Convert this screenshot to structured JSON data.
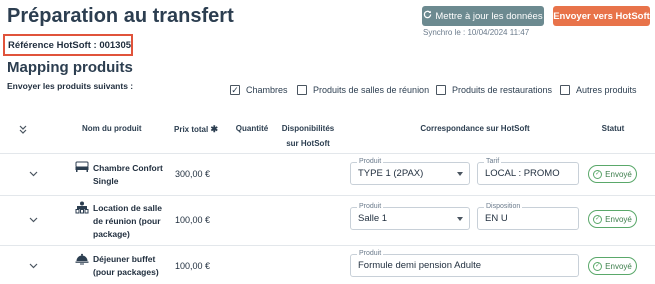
{
  "header": {
    "title": "Préparation au transfert",
    "sync_button": "Mettre à jour les données",
    "send_button": "Envoyer vers HotSoft",
    "sync_text": "Synchro le : 10/04/2024 11:47",
    "reference": "Référence HotSoft : 001305"
  },
  "section": {
    "title": "Mapping produits",
    "send_label": "Envoyer les produits suivants :"
  },
  "filters": [
    {
      "label": "Chambres",
      "checked": true
    },
    {
      "label": "Produits de salles de réunion",
      "checked": false
    },
    {
      "label": "Produits de restaurations",
      "checked": false
    },
    {
      "label": "Autres produits",
      "checked": false
    }
  ],
  "columns": {
    "name": "Nom du produit",
    "price": "Prix total",
    "quantity": "Quantité",
    "availability": "Disponibilités sur HotSoft",
    "mapping": "Correspondance sur HotSoft",
    "status": "Statut"
  },
  "rows": [
    {
      "name": "Chambre Confort Single",
      "price": "300,00 €",
      "icon": "bed-icon",
      "field1_label": "Produit",
      "field1_value": "TYPE 1 (2PAX)",
      "field2_label": "Tarif",
      "field2_value": "LOCAL : PROMO",
      "status": "Envoyé"
    },
    {
      "name": "Location de salle de réunion (pour package)",
      "price": "100,00 €",
      "icon": "meeting-room-icon",
      "field1_label": "Produit",
      "field1_value": "Salle 1",
      "field2_label": "Disposition",
      "field2_value": "EN U",
      "status": "Envoyé"
    },
    {
      "name": "Déjeuner buffet (pour packages)",
      "price": "100,00 €",
      "icon": "cloche-icon",
      "field1_label": "Produit",
      "field1_value": "Formule demi pension Adulte",
      "status": "Envoyé"
    }
  ],
  "colors": {
    "title": "#2c3e50",
    "sync_button": "#6c8a90",
    "send_button": "#e8734a",
    "reference_border": "#e0533b",
    "status_green": "#5aa86a"
  }
}
